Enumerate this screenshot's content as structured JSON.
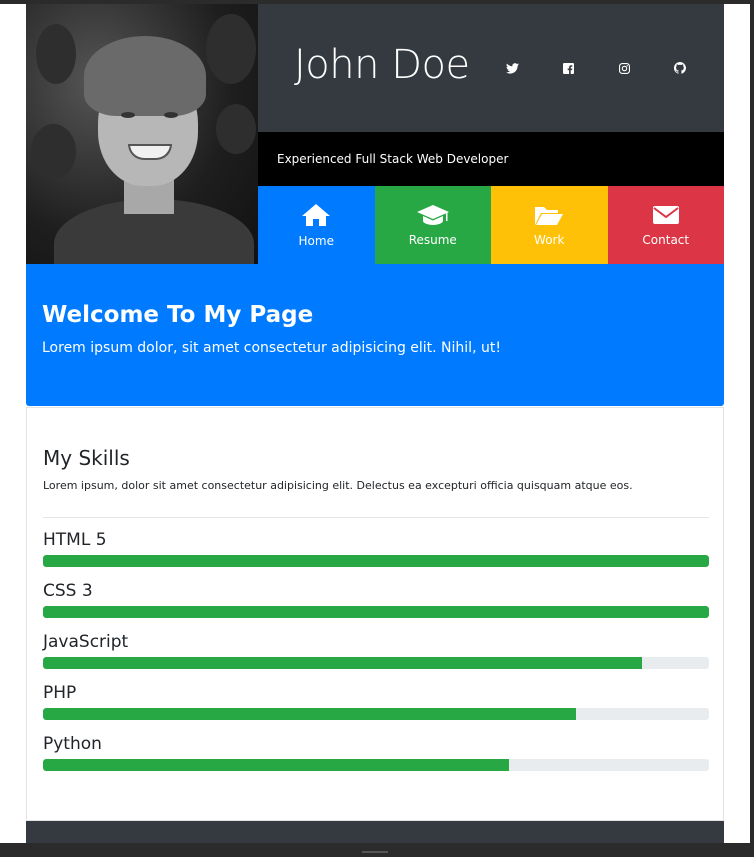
{
  "header": {
    "name": "John Doe",
    "tagline": "Experienced Full Stack Web Developer",
    "social": [
      {
        "icon": "twitter-icon"
      },
      {
        "icon": "facebook-icon"
      },
      {
        "icon": "instagram-icon"
      },
      {
        "icon": "github-icon"
      }
    ]
  },
  "nav": {
    "home": "Home",
    "resume": "Resume",
    "work": "Work",
    "contact": "Contact"
  },
  "welcome": {
    "title": "Welcome To My Page",
    "text": "Lorem ipsum dolor, sit amet consectetur adipisicing elit. Nihil, ut!"
  },
  "skills": {
    "title": "My Skills",
    "intro": "Lorem ipsum, dolor sit amet consectetur adipisicing elit. Delectus ea excepturi officia quisquam atque eos.",
    "items": [
      {
        "label": "HTML 5",
        "percent": 100
      },
      {
        "label": "CSS 3",
        "percent": 100
      },
      {
        "label": "JavaScript",
        "percent": 90
      },
      {
        "label": "PHP",
        "percent": 80
      },
      {
        "label": "Python",
        "percent": 70
      }
    ]
  },
  "colors": {
    "primary": "#007bff",
    "success": "#28a745",
    "warning": "#ffc107",
    "danger": "#dc3545",
    "dark": "#343a40"
  }
}
